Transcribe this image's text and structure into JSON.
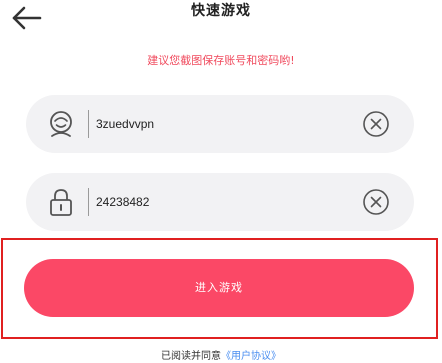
{
  "header": {
    "title": "快速游戏",
    "back_icon": "back-arrow-icon"
  },
  "notice": {
    "text": "建议您截图保存账号和密码哟!",
    "color": "#f04a5d"
  },
  "account_field": {
    "icon": "user-avatar-icon",
    "value": "3zuedvvpn",
    "clear_icon": "clear-circle-icon"
  },
  "password_field": {
    "icon": "lock-icon",
    "value": "24238482",
    "clear_icon": "clear-circle-icon"
  },
  "enter_button": {
    "label": "进入游戏",
    "color": "#fb4866"
  },
  "agreement": {
    "prefix": "已阅读并同意",
    "link_text": "《用户协议》",
    "link_color": "#4a8ef0"
  },
  "highlight_color": "#e02020"
}
